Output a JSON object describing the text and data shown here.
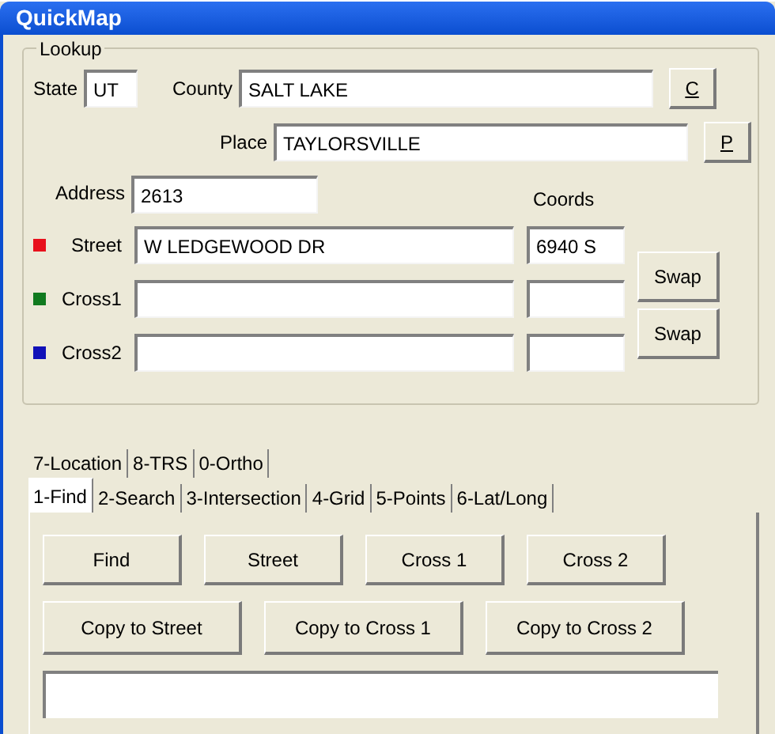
{
  "window": {
    "title": "QuickMap"
  },
  "lookup": {
    "title": "Lookup",
    "state": {
      "label": "State",
      "value": "UT"
    },
    "county": {
      "label": "County",
      "value": "SALT LAKE",
      "button": {
        "label": "C",
        "underlined": true
      }
    },
    "place": {
      "label": "Place",
      "value": "TAYLORSVILLE",
      "button": {
        "label": "P",
        "underlined": true
      }
    },
    "address": {
      "label": "Address",
      "value": "2613"
    },
    "coords_label": "Coords",
    "streets": [
      {
        "label": "Street",
        "color": "#e8101c",
        "value": "W LEDGEWOOD DR",
        "coords": "6940 S"
      },
      {
        "label": "Cross1",
        "color": "#117a1f"
      },
      {
        "label": "Cross2",
        "color": "#1010b8"
      }
    ],
    "swap_buttons": [
      "Swap",
      "Swap"
    ]
  },
  "tab_rows": [
    [
      {
        "label": "7-Location",
        "selected": false
      },
      {
        "label": "8-TRS",
        "selected": false
      },
      {
        "label": "0-Ortho",
        "selected": false
      }
    ],
    [
      {
        "label": "1-Find",
        "selected": true
      },
      {
        "label": "2-Search",
        "selected": false
      },
      {
        "label": "3-Intersection",
        "selected": false
      },
      {
        "label": "4-Grid",
        "selected": false
      },
      {
        "label": "5-Points",
        "selected": false
      },
      {
        "label": "6-Lat/Long",
        "selected": false
      }
    ]
  ],
  "find_buttons": [
    {
      "label": "Find"
    },
    {
      "label": "Street"
    },
    {
      "label": "Cross 1"
    },
    {
      "label": "Cross 2"
    }
  ],
  "copy_buttons": [
    {
      "label": "Copy to Street"
    },
    {
      "label": "Copy to Cross 1"
    },
    {
      "label": "Copy to Cross 2"
    }
  ]
}
